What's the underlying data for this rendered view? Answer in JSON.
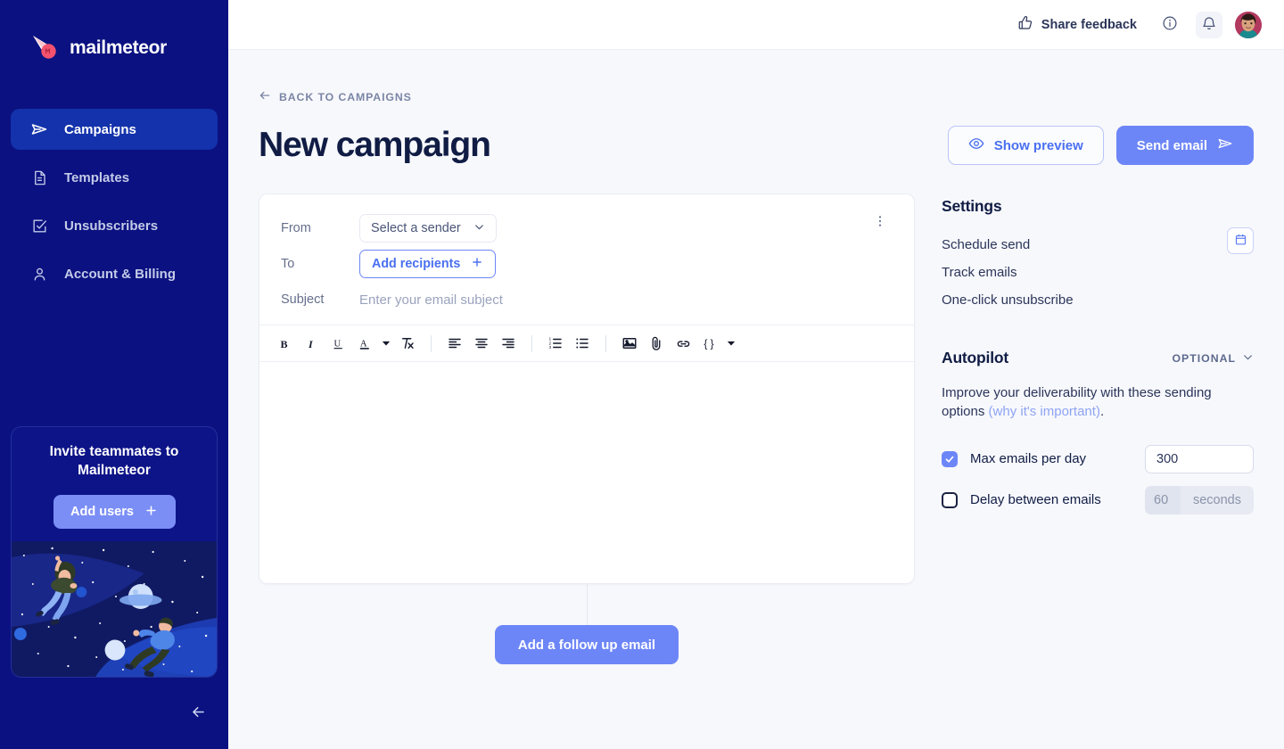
{
  "sidebar": {
    "brand": "mailmeteor",
    "brand_icon": "meteor-logo-icon",
    "items": [
      {
        "label": "Campaigns",
        "icon": "paper-plane-icon",
        "active": true
      },
      {
        "label": "Templates",
        "icon": "document-icon",
        "active": false
      },
      {
        "label": "Unsubscribers",
        "icon": "checkbox-square-icon",
        "active": false
      },
      {
        "label": "Account & Billing",
        "icon": "user-icon",
        "active": false
      }
    ],
    "invite_card": {
      "title": "Invite teammates to Mailmeteor",
      "button_label": "Add users",
      "button_icon": "plus-icon",
      "illustration": "astronauts-in-space-illustration"
    },
    "collapse_icon": "arrow-left-icon"
  },
  "topbar": {
    "feedback_label": "Share feedback",
    "feedback_icon": "thumbs-up-icon",
    "info_icon": "info-circle-icon",
    "bell_icon": "bell-icon",
    "avatar": "user-avatar"
  },
  "page": {
    "back_label": "BACK TO CAMPAIGNS",
    "back_icon": "arrow-left-icon",
    "title": "New campaign",
    "preview_label": "Show preview",
    "preview_icon": "eye-icon",
    "send_label": "Send email",
    "send_icon": "paper-plane-icon"
  },
  "compose": {
    "from_label": "From",
    "from_value": "Select a sender",
    "from_caret_icon": "chevron-down-icon",
    "to_label": "To",
    "to_button": "Add recipients",
    "to_button_icon": "plus-icon",
    "subject_label": "Subject",
    "subject_value": "",
    "subject_placeholder": "Enter your email subject",
    "kebab_icon": "more-vertical-icon",
    "body_value": "",
    "toolbar": [
      {
        "name": "bold-icon",
        "glyph": "B"
      },
      {
        "name": "italic-icon",
        "glyph": "I"
      },
      {
        "name": "underline-icon",
        "glyph": "U"
      },
      {
        "name": "text-color-icon",
        "glyph": "A"
      },
      {
        "name": "text-color-caret-icon",
        "glyph": "caret"
      },
      {
        "name": "clear-formatting-icon",
        "glyph": "Tx"
      },
      {
        "name": "separator",
        "glyph": "sep"
      },
      {
        "name": "align-left-icon",
        "glyph": "align-left"
      },
      {
        "name": "align-center-icon",
        "glyph": "align-center"
      },
      {
        "name": "align-right-icon",
        "glyph": "align-right"
      },
      {
        "name": "separator",
        "glyph": "sep"
      },
      {
        "name": "ordered-list-icon",
        "glyph": "ol"
      },
      {
        "name": "bullet-list-icon",
        "glyph": "ul"
      },
      {
        "name": "separator",
        "glyph": "sep"
      },
      {
        "name": "insert-image-icon",
        "glyph": "image"
      },
      {
        "name": "attachment-icon",
        "glyph": "paperclip"
      },
      {
        "name": "insert-link-icon",
        "glyph": "link"
      },
      {
        "name": "merge-field-icon",
        "glyph": "{}"
      },
      {
        "name": "merge-field-caret-icon",
        "glyph": "caret"
      }
    ],
    "follow_up_label": "Add a follow up email"
  },
  "settings": {
    "title": "Settings",
    "rows": [
      {
        "label": "Schedule send",
        "icon": "calendar-icon"
      },
      {
        "label": "Track emails",
        "icon": ""
      },
      {
        "label": "One-click unsubscribe",
        "icon": ""
      }
    ]
  },
  "autopilot": {
    "title": "Autopilot",
    "optional_label": "OPTIONAL",
    "optional_caret_icon": "chevron-down-icon",
    "description": "Improve your deliverability with these sending options ",
    "link_text": "(why it's important)",
    "description_end": ".",
    "max_emails": {
      "label": "Max emails per day",
      "checked": true,
      "value": "300"
    },
    "delay": {
      "label": "Delay between emails",
      "checked": false,
      "value": "60",
      "unit": "seconds"
    }
  },
  "colors": {
    "sidebar_bg": "#0b1180",
    "sidebar_active": "#1332ab",
    "accent_blue": "#6d86f7",
    "link_blue": "#4a6ff0",
    "page_bg": "#f7f8fc",
    "title_navy": "#101c44",
    "brand_red": "#f2526e"
  }
}
